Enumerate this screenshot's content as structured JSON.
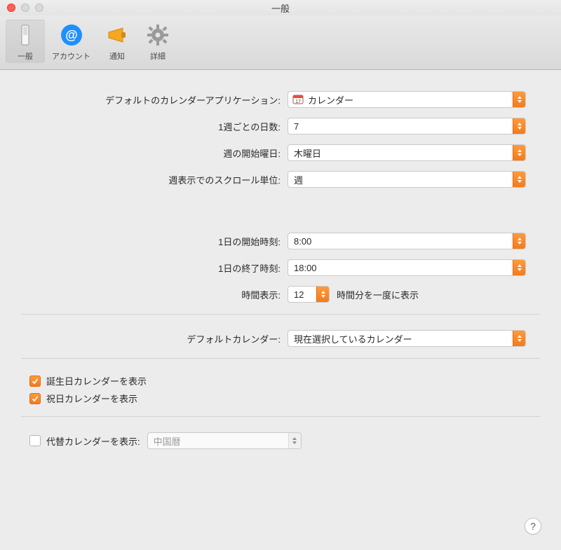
{
  "window": {
    "title": "一般"
  },
  "toolbar": {
    "general": "一般",
    "accounts": "アカウント",
    "notifications": "通知",
    "advanced": "詳細"
  },
  "labels": {
    "default_app": "デフォルトのカレンダーアプリケーション:",
    "days_per_week": "1週ごとの日数:",
    "week_start": "週の開始曜日:",
    "week_scroll": "週表示でのスクロール単位:",
    "day_start": "1日の開始時刻:",
    "day_end": "1日の終了時刻:",
    "time_display": "時間表示:",
    "time_suffix": "時間分を一度に表示",
    "default_calendar": "デフォルトカレンダー:",
    "show_birthday": "誕生日カレンダーを表示",
    "show_holiday": "祝日カレンダーを表示",
    "alt_calendar": "代替カレンダーを表示:"
  },
  "values": {
    "default_app": "カレンダー",
    "days_per_week": "7",
    "week_start": "木曜日",
    "week_scroll": "週",
    "day_start": "8:00",
    "day_end": "18:00",
    "hours_at_time": "12",
    "default_calendar": "現在選択しているカレンダー",
    "alt_calendar": "中国暦"
  },
  "checkboxes": {
    "birthday": true,
    "holiday": true,
    "alt": false
  },
  "help": "?"
}
